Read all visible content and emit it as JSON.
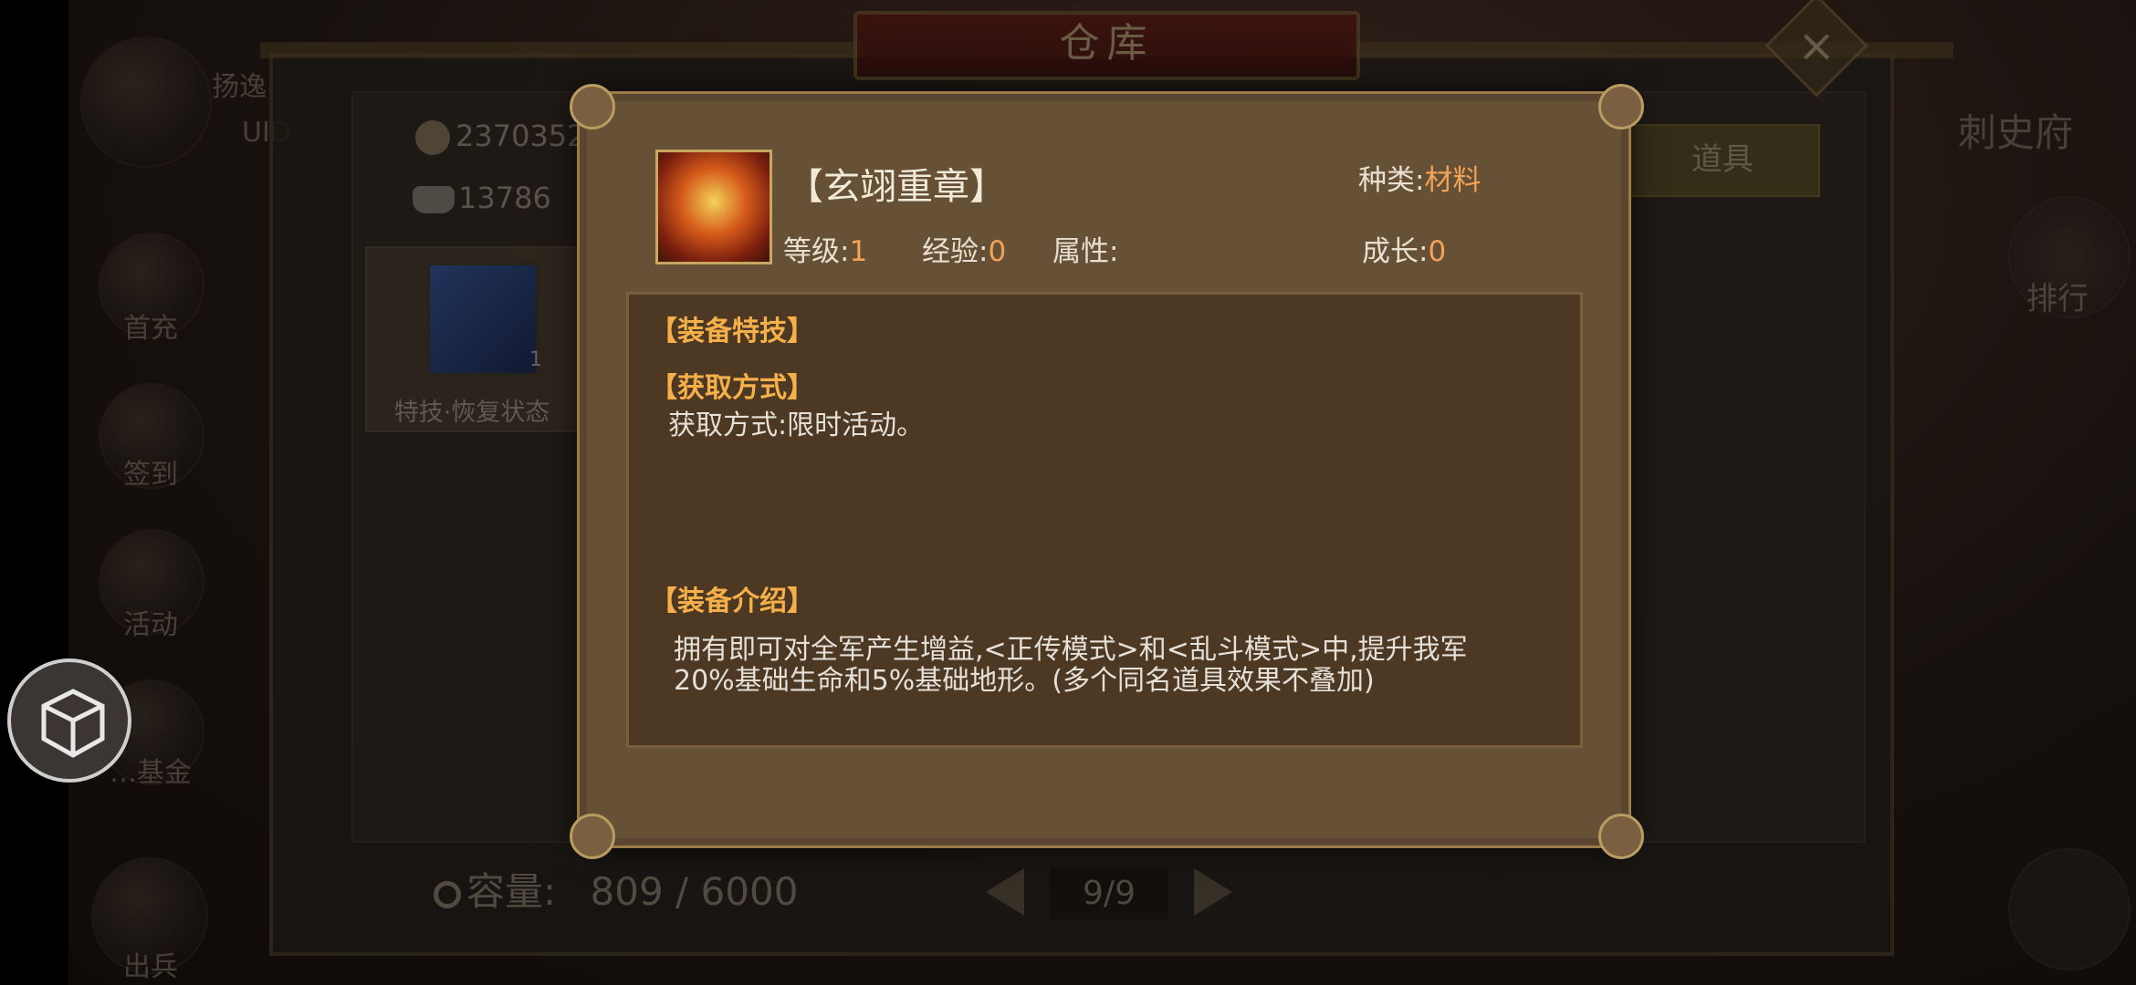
{
  "background": {
    "user_name_partial": "扬逸",
    "uid_label": "UID",
    "coins": "2370352",
    "ingots": "13786",
    "side_menu": [
      "首充",
      "签到",
      "活动",
      "…基金",
      "出兵"
    ],
    "slot": {
      "count": "1",
      "label": "特技·恢复状态"
    },
    "tabs": {
      "items": "道具"
    },
    "right_labels": {
      "top": "刺史府",
      "rank": "排行"
    },
    "capacity_label": "容量:",
    "capacity_value": "809 / 6000",
    "page": "9/9",
    "title": "仓库"
  },
  "popup": {
    "item_name": "【玄翊重章】",
    "category_label": "种类:",
    "category_value": "材料",
    "level_label": "等级:",
    "level_value": "1",
    "exp_label": "经验:",
    "exp_value": "0",
    "attr_label": "属性:",
    "growth_label": "成长:",
    "growth_value": "0",
    "sections": {
      "skill_title": "【装备特技】",
      "obtain_title": "【获取方式】",
      "obtain_text": "获取方式:限时活动。",
      "intro_title": "【装备介绍】",
      "intro_line1": "拥有即可对全军产生增益,<正传模式>和<乱斗模式>中,提升我军",
      "intro_line2": "20%基础生命和5%基础地形。(多个同名道具效果不叠加)"
    }
  },
  "colors": {
    "accent_orange": "#f2a356",
    "section_title": "#f5b04a",
    "popup_bg": "#665036"
  }
}
